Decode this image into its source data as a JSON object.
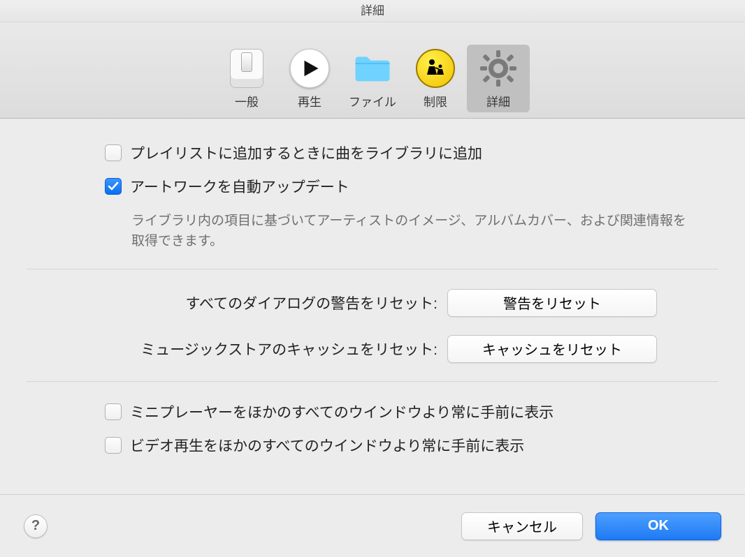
{
  "window": {
    "title": "詳細"
  },
  "toolbar": {
    "items": [
      {
        "id": "general",
        "label": "一般"
      },
      {
        "id": "playback",
        "label": "再生"
      },
      {
        "id": "files",
        "label": "ファイル"
      },
      {
        "id": "restrict",
        "label": "制限"
      },
      {
        "id": "advanced",
        "label": "詳細"
      }
    ],
    "selected": "advanced"
  },
  "checkboxes": {
    "add_to_library": {
      "checked": false,
      "label": "プレイリストに追加するときに曲をライブラリに追加"
    },
    "auto_artwork": {
      "checked": true,
      "label": "アートワークを自動アップデート"
    },
    "auto_artwork_desc": "ライブラリ内の項目に基づいてアーティストのイメージ、アルバムカバー、および関連情報を取得できます。",
    "miniplayer_top": {
      "checked": false,
      "label": "ミニプレーヤーをほかのすべてのウインドウより常に手前に表示"
    },
    "video_top": {
      "checked": false,
      "label": "ビデオ再生をほかのすべてのウインドウより常に手前に表示"
    }
  },
  "actions": {
    "reset_warnings": {
      "label": "すべてのダイアログの警告をリセット:",
      "button": "警告をリセット"
    },
    "reset_cache": {
      "label": "ミュージックストアのキャッシュをリセット:",
      "button": "キャッシュをリセット"
    }
  },
  "footer": {
    "help": "?",
    "cancel": "キャンセル",
    "ok": "OK"
  }
}
